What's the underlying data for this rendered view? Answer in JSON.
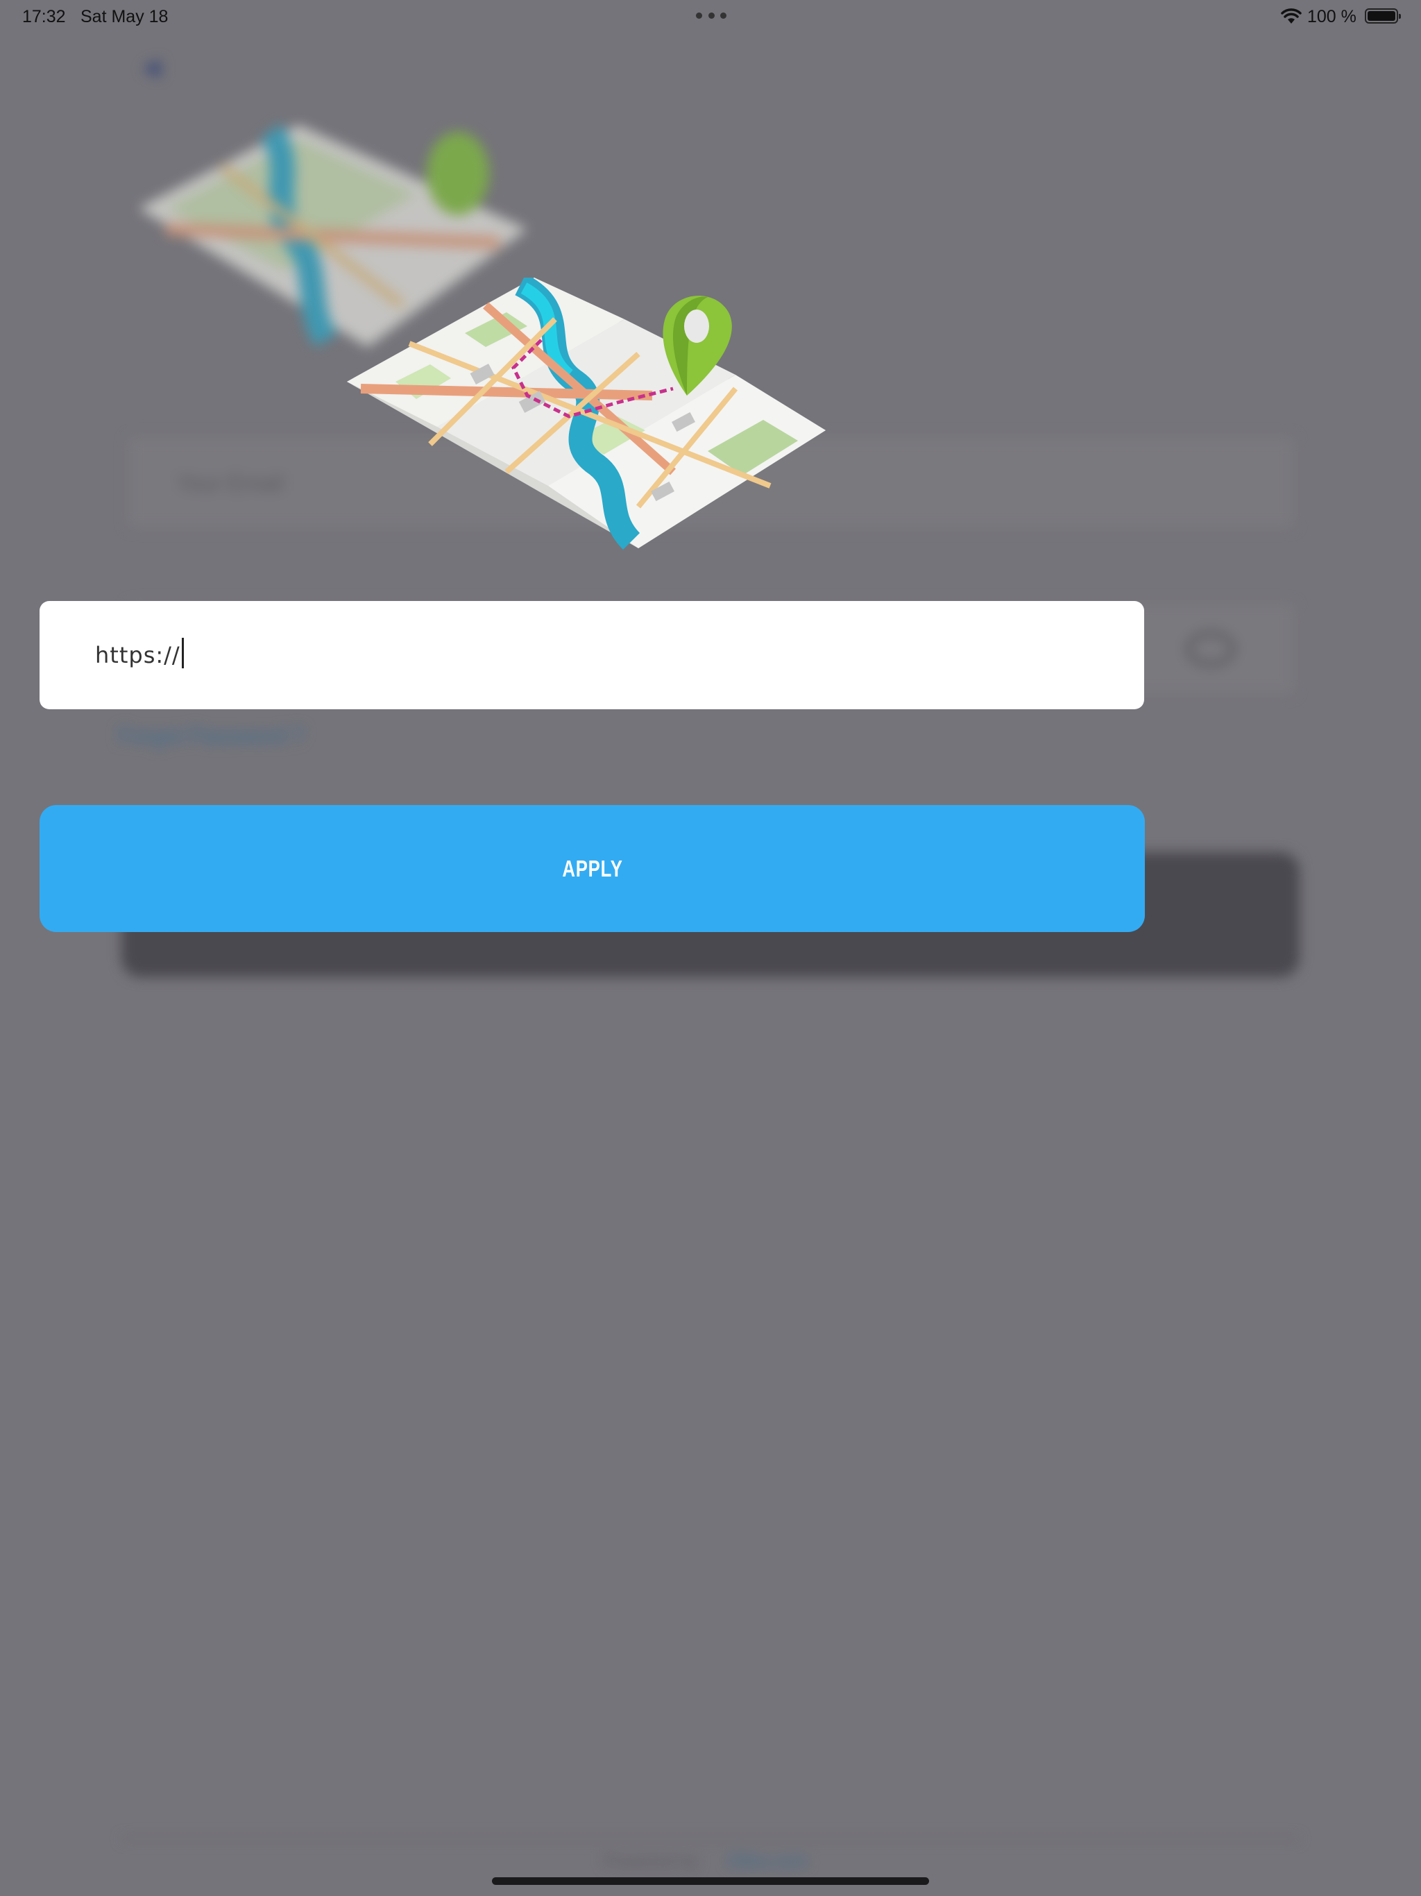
{
  "status_bar": {
    "time": "17:32",
    "date": "Sat May 18",
    "battery": "100 %"
  },
  "background": {
    "email_placeholder": "Your Email",
    "forgot_password": "Forgot Password ?",
    "footer_text": "Powered by",
    "footer_link": "Ollos.com"
  },
  "url_input": {
    "value": "https://",
    "placeholder": "https://"
  },
  "apply_button": {
    "label": "APPLY"
  },
  "colors": {
    "overlay": "#75747a",
    "accent": "#33abf2",
    "pin_green": "#8cc43a",
    "river": "#2aa9c9"
  },
  "icons": [
    "back-icon",
    "map-illustration",
    "map-pin-icon",
    "eye-icon",
    "wifi-icon",
    "battery-icon"
  ]
}
